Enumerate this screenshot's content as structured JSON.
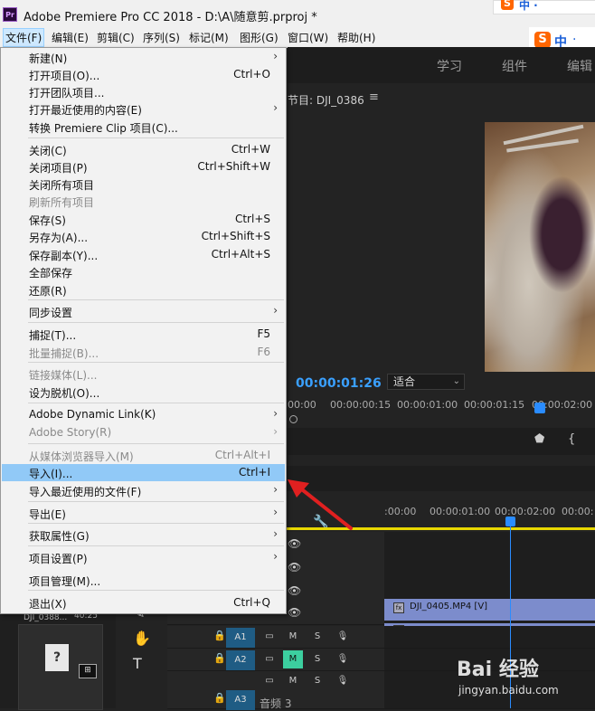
{
  "window": {
    "app_icon": "Pr",
    "title": "Adobe Premiere Pro CC 2018 - D:\\A\\随意剪.prproj *"
  },
  "ime": {
    "top_text": "中 ·",
    "bar_zh": "中",
    "bar_dot": "·"
  },
  "menubar": {
    "items": [
      "文件(F)",
      "编辑(E)",
      "剪辑(C)",
      "序列(S)",
      "标记(M)",
      "图形(G)",
      "窗口(W)",
      "帮助(H)"
    ],
    "active_index": 0
  },
  "workspaces": [
    "学习",
    "组件",
    "编辑"
  ],
  "program_monitor": {
    "title": "节目: DJI_0386",
    "menu_icon": "hamburger-icon",
    "timecode": "00:00:01:26",
    "fit": "适合",
    "ruler": [
      "00:00",
      "00:00:00:15",
      "00:00:01:00",
      "00:00:01:15",
      "00:00:02:00"
    ]
  },
  "file_menu": {
    "items": [
      {
        "label": "新建(N)",
        "shortcut": "",
        "submenu": true,
        "disabled": false
      },
      {
        "label": "打开项目(O)...",
        "shortcut": "Ctrl+O",
        "submenu": false,
        "disabled": false
      },
      {
        "label": "打开团队项目...",
        "shortcut": "",
        "submenu": false,
        "disabled": false
      },
      {
        "label": "打开最近使用的内容(E)",
        "shortcut": "",
        "submenu": true,
        "disabled": false
      },
      {
        "label": "转换 Premiere Clip 项目(C)...",
        "shortcut": "",
        "submenu": false,
        "disabled": false
      },
      {
        "label": "关闭(C)",
        "shortcut": "Ctrl+W",
        "submenu": false,
        "disabled": false
      },
      {
        "label": "关闭项目(P)",
        "shortcut": "Ctrl+Shift+W",
        "submenu": false,
        "disabled": false
      },
      {
        "label": "关闭所有项目",
        "shortcut": "",
        "submenu": false,
        "disabled": false
      },
      {
        "label": "刷新所有项目",
        "shortcut": "",
        "submenu": false,
        "disabled": true
      },
      {
        "label": "保存(S)",
        "shortcut": "Ctrl+S",
        "submenu": false,
        "disabled": false
      },
      {
        "label": "另存为(A)...",
        "shortcut": "Ctrl+Shift+S",
        "submenu": false,
        "disabled": false
      },
      {
        "label": "保存副本(Y)...",
        "shortcut": "Ctrl+Alt+S",
        "submenu": false,
        "disabled": false
      },
      {
        "label": "全部保存",
        "shortcut": "",
        "submenu": false,
        "disabled": false
      },
      {
        "label": "还原(R)",
        "shortcut": "",
        "submenu": false,
        "disabled": false
      },
      {
        "label": "同步设置",
        "shortcut": "",
        "submenu": true,
        "disabled": false
      },
      {
        "label": "捕捉(T)...",
        "shortcut": "F5",
        "submenu": false,
        "disabled": false
      },
      {
        "label": "批量捕捉(B)...",
        "shortcut": "F6",
        "submenu": false,
        "disabled": true
      },
      {
        "label": "链接媒体(L)...",
        "shortcut": "",
        "submenu": false,
        "disabled": true
      },
      {
        "label": "设为脱机(O)...",
        "shortcut": "",
        "submenu": false,
        "disabled": false
      },
      {
        "label": "Adobe Dynamic Link(K)",
        "shortcut": "",
        "submenu": true,
        "disabled": false
      },
      {
        "label": "Adobe Story(R)",
        "shortcut": "",
        "submenu": true,
        "disabled": true
      },
      {
        "label": "从媒体浏览器导入(M)",
        "shortcut": "Ctrl+Alt+I",
        "submenu": false,
        "disabled": true
      },
      {
        "label": "导入(I)...",
        "shortcut": "Ctrl+I",
        "submenu": false,
        "disabled": false
      },
      {
        "label": "导入最近使用的文件(F)",
        "shortcut": "",
        "submenu": true,
        "disabled": false
      },
      {
        "label": "导出(E)",
        "shortcut": "",
        "submenu": true,
        "disabled": false
      },
      {
        "label": "获取属性(G)",
        "shortcut": "",
        "submenu": true,
        "disabled": false
      },
      {
        "label": "项目设置(P)",
        "shortcut": "",
        "submenu": true,
        "disabled": false
      },
      {
        "label": "项目管理(M)...",
        "shortcut": "",
        "submenu": false,
        "disabled": false
      },
      {
        "label": "退出(X)",
        "shortcut": "Ctrl+Q",
        "submenu": false,
        "disabled": false
      }
    ],
    "highlighted_label": "导入(I)..."
  },
  "timeline": {
    "ruler": [
      ":00:00",
      "00:00:01:00",
      "00:00:02:00",
      "00:00:"
    ],
    "video_clip": "DJI_0405.MP4 [V]",
    "fx_badge": "fx",
    "tracks": {
      "a1": "A1",
      "a2": "A2",
      "a3": "A3",
      "m": "M",
      "s": "S",
      "audio3_name": "音频 3"
    }
  },
  "project_panel": {
    "clip_name": "DJI_0388...",
    "clip_duration": "40:25",
    "clip_icon": "?"
  },
  "watermark": {
    "line1": "Bai 经验",
    "line2": "jingyan.baidu.com"
  },
  "colors": {
    "highlight": "#91c9f7",
    "accent": "#2a8cff",
    "timecode": "#3aa0ff",
    "arrow": "#e02020",
    "clip": "#7c8ccc",
    "mute_on": "#3ccf9f"
  }
}
